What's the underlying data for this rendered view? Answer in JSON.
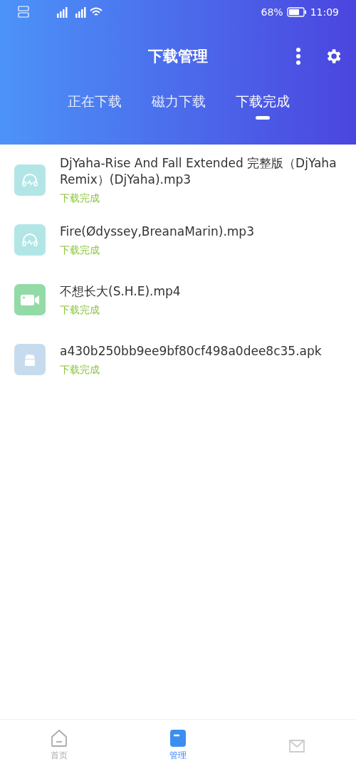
{
  "status_bar": {
    "battery": "68%",
    "time": "11:09"
  },
  "header": {
    "title": "下载管理"
  },
  "tabs": [
    {
      "label": "正在下载",
      "selected": false
    },
    {
      "label": "磁力下载",
      "selected": false
    },
    {
      "label": "下载完成",
      "selected": true
    }
  ],
  "downloads": [
    {
      "kind": "audio",
      "name": "DjYaha-Rise And Fall Extended 完整版（DjYaha Remix）(DjYaha).mp3",
      "status": "下载完成"
    },
    {
      "kind": "audio",
      "name": "Fire(Ødyssey,BreanaMarin).mp3",
      "status": "下载完成"
    },
    {
      "kind": "video",
      "name": "不想长大(S.H.E).mp4",
      "status": "下载完成"
    },
    {
      "kind": "apk",
      "name": "a430b250bb9ee9bf80cf498a0dee8c35.apk",
      "status": "下载完成"
    }
  ],
  "bottom_nav": [
    {
      "kind": "home",
      "label": "首页",
      "selected": false
    },
    {
      "kind": "manage",
      "label": "管理",
      "selected": true
    },
    {
      "kind": "mail",
      "selected": false
    }
  ]
}
